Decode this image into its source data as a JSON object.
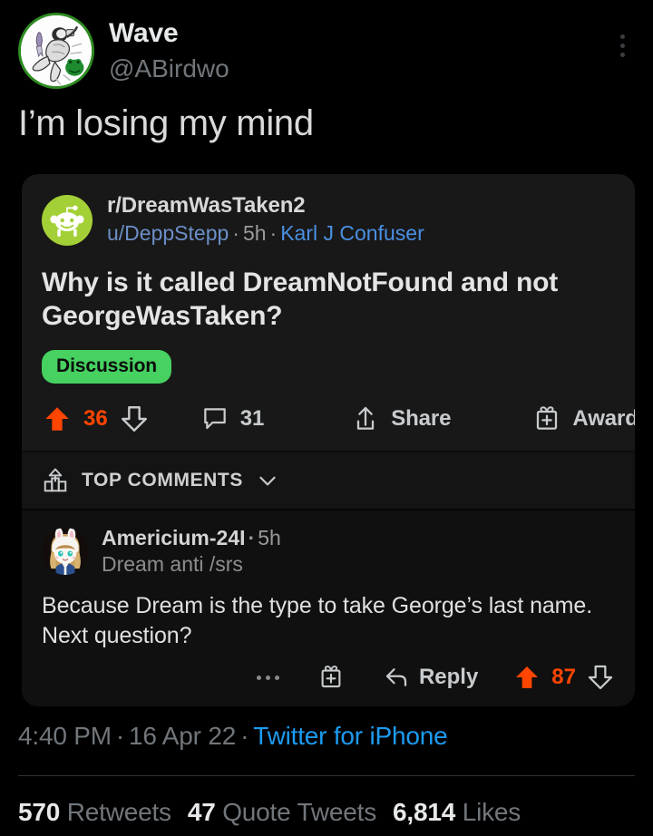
{
  "tweet": {
    "display_name": "Wave",
    "handle": "@ABirdwo",
    "text": "I’m losing my mind",
    "more_icon": "more-vertical-icon",
    "avatar_icon": "profile-avatar-astronaut-drawing",
    "time": "4:40 PM",
    "date": "16 Apr 22",
    "source": "Twitter for iPhone",
    "separator": "·"
  },
  "stats": {
    "retweets_count": "570",
    "retweets_label": "Retweets",
    "quotes_count": "47",
    "quotes_label": "Quote Tweets",
    "likes_count": "6,814",
    "likes_label": "Likes"
  },
  "reddit_card": {
    "subreddit": "r/DreamWasTaken2",
    "author": "u/DeppStepp",
    "age": "5h",
    "author_flair": "Karl J Confuser",
    "separator": "·",
    "title": "Why is it called DreamNotFound and not GeorgeWasTaken?",
    "flair": "Discussion",
    "subreddit_icon": "reddit-snoo-icon",
    "actions": {
      "upvote_icon": "upvote-arrow-icon",
      "score": "36",
      "downvote_icon": "downvote-arrow-icon",
      "comment_icon": "comment-bubble-icon",
      "comment_count": "31",
      "share_icon": "share-icon",
      "share_label": "Share",
      "award_icon": "award-gift-icon",
      "award_label": "Award"
    },
    "sort": {
      "icon": "sort-podium-icon",
      "label": "TOP COMMENTS",
      "chevron_icon": "chevron-down-icon"
    },
    "comment": {
      "avatar_icon": "comment-avatar-bunny-hood-girl",
      "author": "Americium-24I",
      "age": "5h",
      "flair": "Dream anti /srs",
      "body": "Because Dream is the type to take George’s last name. Next question?",
      "actions": {
        "overflow_icon": "ellipsis-icon",
        "gift_icon": "award-gift-icon",
        "reply_icon": "reply-arrow-icon",
        "reply_label": "Reply",
        "upvote_icon": "upvote-arrow-icon",
        "score": "87",
        "downvote_icon": "downvote-arrow-icon"
      }
    }
  },
  "colors": {
    "page_background": "#000000",
    "card_background": "#181818",
    "upvote_orange": "#ff4500",
    "flair_green": "#46d160",
    "snoo_green": "#a4d037",
    "link_blue": "#1d9bf0",
    "avatar_ring_green": "#2e8b22"
  }
}
